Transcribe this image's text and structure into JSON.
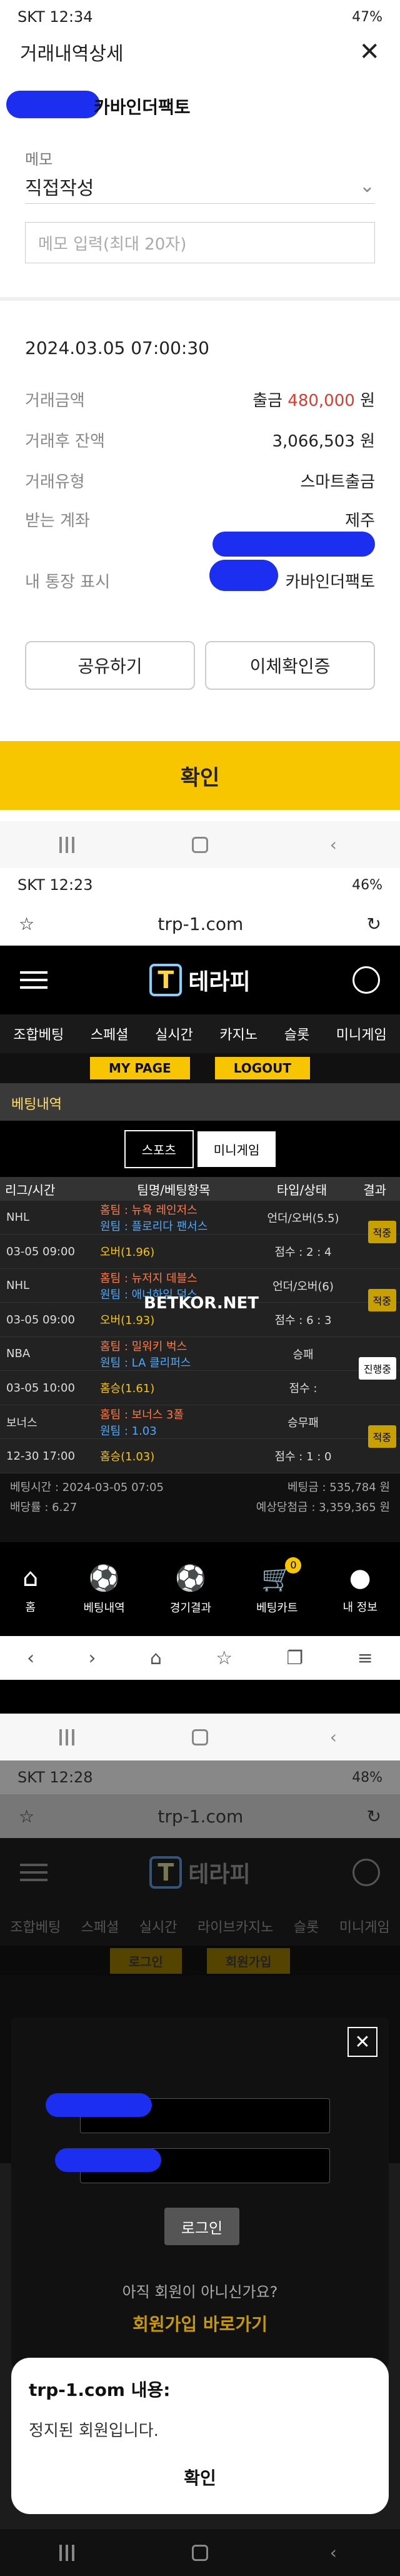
{
  "shot1": {
    "status": {
      "time": "SKT 12:34",
      "battery": "47%"
    },
    "title": "거래내역상세",
    "close": "✕",
    "merchant": "카바인더팩토",
    "memo_label": "메모",
    "memo_select": "직접작성",
    "memo_placeholder": "메모 입력(최대 20자)",
    "datetime": "2024.03.05 07:00:30",
    "rows": [
      {
        "k": "거래금액",
        "pre": "출금 ",
        "amount": "480,000",
        "post": " 원"
      },
      {
        "k": "거래후 잔액",
        "v": "3,066,503 원"
      },
      {
        "k": "거래유형",
        "v": "스마트출금"
      },
      {
        "k": "받는 계좌",
        "v": "제주"
      },
      {
        "k": "내 통장 표시",
        "v": "카바인더팩토"
      }
    ],
    "share_btn": "공유하기",
    "verify_btn": "이체확인증",
    "confirm_btn": "확인"
  },
  "shot2": {
    "status": {
      "time": "SKT 12:23",
      "battery": "46%"
    },
    "url": "trp-1.com",
    "logo": "테라피",
    "menu": [
      "조합베팅",
      "스페셜",
      "실시간",
      "카지노",
      "슬롯",
      "미니게임"
    ],
    "subtabs": [
      "MY PAGE",
      "LOGOUT"
    ],
    "banner": "베팅내역",
    "sport_tabs": [
      "스포츠",
      "미니게임"
    ],
    "table_head": {
      "league": "리그/시간",
      "match": "팀명/베팅항목",
      "type": "타입/상태",
      "result": "결과"
    },
    "bets": [
      {
        "league": "NHL",
        "home": "홈팀 : 뉴욕 레인저스",
        "away": "원팀 : 플로리다 팬서스",
        "type": "언더/오버(5.5)",
        "time": "03-05 09:00",
        "pick": "오버(1.96)",
        "score": "점수 : 2 : 4",
        "badge": "적중"
      },
      {
        "league": "NHL",
        "home": "홈팀 : 뉴저지 데블스",
        "away": "원팀 : 애너하임 덕스",
        "type": "언더/오버(6)",
        "time": "03-05 09:00",
        "pick": "오버(1.93)",
        "score": "점수 : 6 : 3",
        "badge": "적중"
      },
      {
        "league": "NBA",
        "home": "홈팀 : 밀워키 벅스",
        "away": "원팀 : LA 클리퍼스",
        "type": "승패",
        "time": "03-05 10:00",
        "pick": "홈승(1.61)",
        "score": "점수 :",
        "badge": "진행중"
      },
      {
        "league": "보너스",
        "home": "홈팀 : 보너스 3폴",
        "away": "원팀 : 1.03",
        "type": "승무패",
        "time": "12-30 17:00",
        "pick": "홈승(1.03)",
        "score": "점수 : 1 : 0",
        "badge": "적중"
      }
    ],
    "watermark": "BETKOR.NET",
    "summary": {
      "bet_time": "베팅시간 : 2024-03-05 07:05",
      "bet_amount": "베팅금 : 535,784 원",
      "odds": "배당률 : 6.27",
      "expected": "예상당첨금 : 3,359,365 원"
    },
    "bottom_nav": [
      "홈",
      "베팅내역",
      "경기결과",
      "베팅카트",
      "내 정보"
    ],
    "cart_count": "0"
  },
  "shot3": {
    "status": {
      "time": "SKT 12:28",
      "battery": "48%"
    },
    "url": "trp-1.com",
    "logo": "테라피",
    "menu": [
      "조합베팅",
      "스페셜",
      "실시간",
      "라이브카지노",
      "슬롯",
      "미니게임"
    ],
    "subtabs": [
      "로그인",
      "회원가입"
    ],
    "login_btn": "로그인",
    "not_member": "아직 회원이 아니신가요?",
    "signup_link": "회원가입 바로가기",
    "dialog_title": "trp-1.com 내용:",
    "dialog_msg": "정지된 회원입니다.",
    "dialog_ok": "확인"
  }
}
